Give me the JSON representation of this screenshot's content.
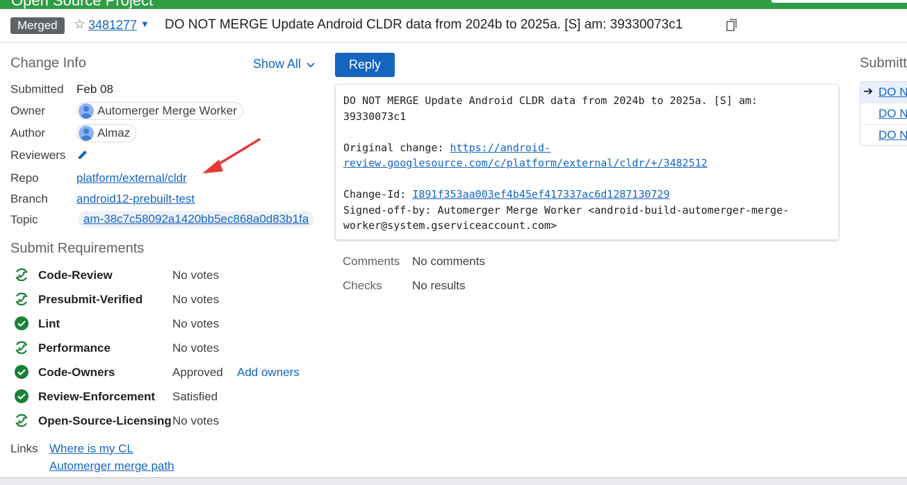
{
  "topbar": {
    "project": "Open Source Project"
  },
  "header": {
    "status_badge": "Merged",
    "change_number": "3481277",
    "subject": "DO NOT MERGE Update Android CLDR data from 2024b to 2025a. [S] am: 39330073c1"
  },
  "change_info": {
    "title": "Change Info",
    "show_all": "Show All",
    "rows": {
      "submitted": {
        "label": "Submitted",
        "value": "Feb 08"
      },
      "owner": {
        "label": "Owner",
        "value": "Automerger Merge Worker"
      },
      "author": {
        "label": "Author",
        "value": "Almaz"
      },
      "reviewers": {
        "label": "Reviewers"
      },
      "repo": {
        "label": "Repo",
        "value": "platform/external/cldr"
      },
      "branch": {
        "label": "Branch",
        "value": "android12-prebuilt-test"
      },
      "topic": {
        "label": "Topic",
        "value": "am-38c7c58092a1420bb5ec868a0d83b1fa"
      }
    }
  },
  "submit_requirements": {
    "title": "Submit Requirements",
    "items": [
      {
        "name": "Code-Review",
        "status": "No votes",
        "icon": "pending-icon"
      },
      {
        "name": "Presubmit-Verified",
        "status": "No votes",
        "icon": "pending-icon"
      },
      {
        "name": "Lint",
        "status": "No votes",
        "icon": "check-circle-icon"
      },
      {
        "name": "Performance",
        "status": "No votes",
        "icon": "pending-icon"
      },
      {
        "name": "Code-Owners",
        "status": "Approved",
        "action": "Add owners",
        "icon": "check-circle-icon"
      },
      {
        "name": "Review-Enforcement",
        "status": "Satisfied",
        "icon": "check-circle-icon"
      },
      {
        "name": "Open-Source-Licensing",
        "status": "No votes",
        "icon": "pending-icon"
      }
    ]
  },
  "links": {
    "label": "Links",
    "items": [
      "Where is my CL",
      "Automerger merge path"
    ]
  },
  "reply_button": "Reply",
  "commit_message": {
    "line1": "DO NOT MERGE Update Android CLDR data from 2024b to 2025a. [S] am:",
    "line2": "39330073c1",
    "original_label": "Original change: ",
    "original_link_1": "https://android-",
    "original_link_2": "review.googlesource.com/c/platform/external/cldr/+/3482512",
    "changeid_label": "Change-Id: ",
    "changeid_value": "I891f353aa003ef4b45ef417337ac6d1287130729",
    "signed_line1": "Signed-off-by: Automerger Merge Worker <android-build-automerger-merge-",
    "signed_line2": "worker@system.gserviceaccount.com>"
  },
  "comments": {
    "label": "Comments",
    "value": "No comments"
  },
  "checks": {
    "label": "Checks",
    "value": "No results"
  },
  "related": {
    "title": "Submitted",
    "items": [
      "DO NOT MERGE",
      "DO NOT MERGE",
      "DO NOT MERGE"
    ]
  },
  "colors": {
    "topbar": "#2e9d46",
    "link": "#1565c0",
    "success": "#188038",
    "badge": "#5f6368",
    "arrow": "#e53935"
  }
}
